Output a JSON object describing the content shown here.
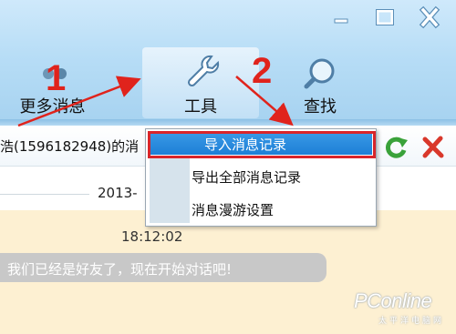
{
  "window": {
    "controls": [
      "minimize-icon",
      "maximize-icon",
      "close-icon"
    ]
  },
  "toolbar": {
    "more_messages": "更多消息",
    "tools": "工具",
    "search": "查找"
  },
  "annotations": {
    "step1": "1",
    "step2": "2",
    "color": "#e0231c"
  },
  "conversation": {
    "title": "浩(1596182948)的消"
  },
  "menu": {
    "items": [
      {
        "label": "导入消息记录",
        "selected": true
      },
      {
        "label": "导出全部消息记录",
        "selected": false
      },
      {
        "label": "消息漫游设置",
        "selected": false
      }
    ]
  },
  "chat": {
    "date": "2013-",
    "time": "18:12:02",
    "message": "我们已经是好友了，现在开始对话吧!"
  },
  "watermark": {
    "brand": "PConline",
    "sub": "太平洋电脑网"
  },
  "colors": {
    "chrome": "#b7ddf6",
    "menu_highlight": "#2a8ce0",
    "highlight_outline": "#d8252a",
    "chat_background": "#fdf0d2"
  }
}
